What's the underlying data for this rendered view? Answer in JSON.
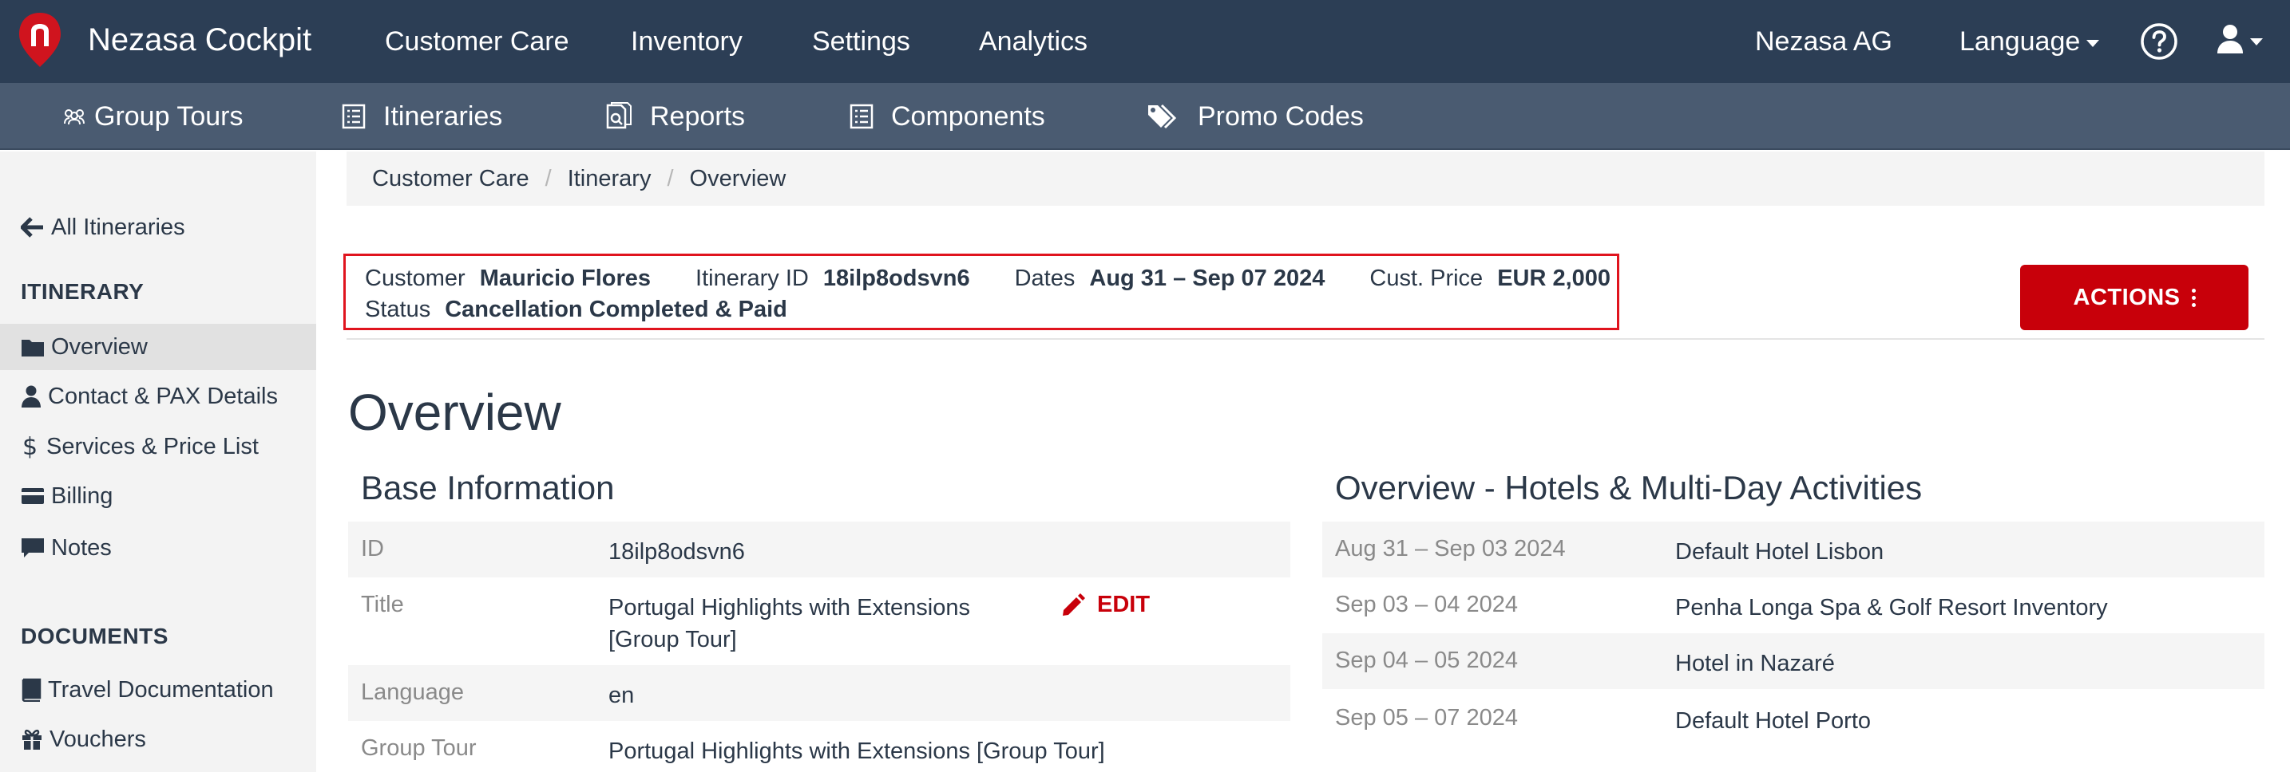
{
  "topbar": {
    "brand": "Nezasa Cockpit",
    "nav": [
      "Customer Care",
      "Inventory",
      "Settings",
      "Analytics"
    ],
    "company": "Nezasa AG",
    "language": "Language"
  },
  "subbar": {
    "items": [
      "Group Tours",
      "Itineraries",
      "Reports",
      "Components",
      "Promo Codes"
    ]
  },
  "sidebar": {
    "back": "All Itineraries",
    "itinerary_heading": "ITINERARY",
    "itinerary_items": [
      "Overview",
      "Contact & PAX Details",
      "Services & Price List",
      "Billing",
      "Notes"
    ],
    "documents_heading": "DOCUMENTS",
    "document_items": [
      "Travel Documentation",
      "Vouchers"
    ]
  },
  "breadcrumb": [
    "Customer Care",
    "Itinerary",
    "Overview"
  ],
  "header": {
    "customer_label": "Customer",
    "customer_value": "Mauricio Flores",
    "id_label": "Itinerary ID",
    "id_value": "18ilp8odsvn6",
    "dates_label": "Dates",
    "dates_value": "Aug 31 – Sep 07 2024",
    "price_label": "Cust. Price",
    "price_value": "EUR 2,000",
    "status_label": "Status",
    "status_value": "Cancellation Completed & Paid",
    "actions_label": "ACTIONS"
  },
  "page_title": "Overview",
  "base_info": {
    "title": "Base Information",
    "rows": [
      {
        "label": "ID",
        "value": "18ilp8odsvn6"
      },
      {
        "label": "Title",
        "value_line1": "Portugal Highlights with Extensions",
        "value_line2": "[Group Tour]",
        "edit": "EDIT"
      },
      {
        "label": "Language",
        "value": "en"
      },
      {
        "label": "Group Tour",
        "value": "Portugal Highlights with Extensions [Group Tour]"
      }
    ]
  },
  "hotels": {
    "title": "Overview - Hotels & Multi-Day Activities",
    "rows": [
      {
        "dates": "Aug 31 – Sep 03 2024",
        "name": "Default Hotel Lisbon"
      },
      {
        "dates": "Sep 03 – 04 2024",
        "name": "Penha Longa Spa & Golf Resort Inventory"
      },
      {
        "dates": "Sep 04 – 05 2024",
        "name": "Hotel in Nazaré"
      },
      {
        "dates": "Sep 05 – 07 2024",
        "name": "Default Hotel Porto"
      }
    ]
  },
  "colors": {
    "topbar": "#2c3e55",
    "subbar": "#4a5b71",
    "accent": "#c8000a",
    "text": "#2b3848"
  }
}
